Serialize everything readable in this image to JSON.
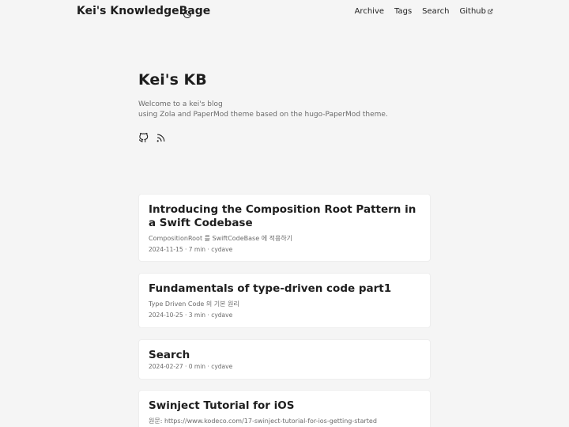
{
  "header": {
    "logo": "Kei's KnowledgeBage",
    "theme_icon": "moon-icon",
    "menu": [
      {
        "label": "Archive"
      },
      {
        "label": "Tags"
      },
      {
        "label": "Search"
      },
      {
        "label": "Github",
        "icon": "external-link-icon"
      }
    ]
  },
  "home": {
    "title": "Kei's KB",
    "desc_line1": "Welcome to a kei's blog",
    "desc_line2": "using Zola and PaperMod theme based on the hugo-PaperMod theme.",
    "social": [
      {
        "icon": "github-icon"
      },
      {
        "icon": "rss-icon"
      }
    ]
  },
  "posts": [
    {
      "title": "Introducing the Composition Root Pattern in a Swift Codebase",
      "summary": "CompositionRoot 를 SwiftCodeBase 에 적용하기",
      "date": "2024-11-15",
      "read": "7 min",
      "author": "cydave"
    },
    {
      "title": "Fundamentals of type-driven code part1",
      "summary": "Type Driven Code 의 기본 원리",
      "date": "2024-10-25",
      "read": "3 min",
      "author": "cydave"
    },
    {
      "title": "Search",
      "summary": "",
      "date": "2024-02-27",
      "read": "0 min",
      "author": "cydave"
    },
    {
      "title": "Swinject Tutorial for iOS",
      "summary": "원문: https://www.kodeco.com/17-swinject-tutorial-for-ios-getting-started",
      "date": "",
      "read": "",
      "author": ""
    }
  ],
  "colors": {
    "background": "#f5f5f5",
    "card": "#ffffff",
    "text": "#1e1e1e",
    "muted": "#6b6b6b"
  }
}
